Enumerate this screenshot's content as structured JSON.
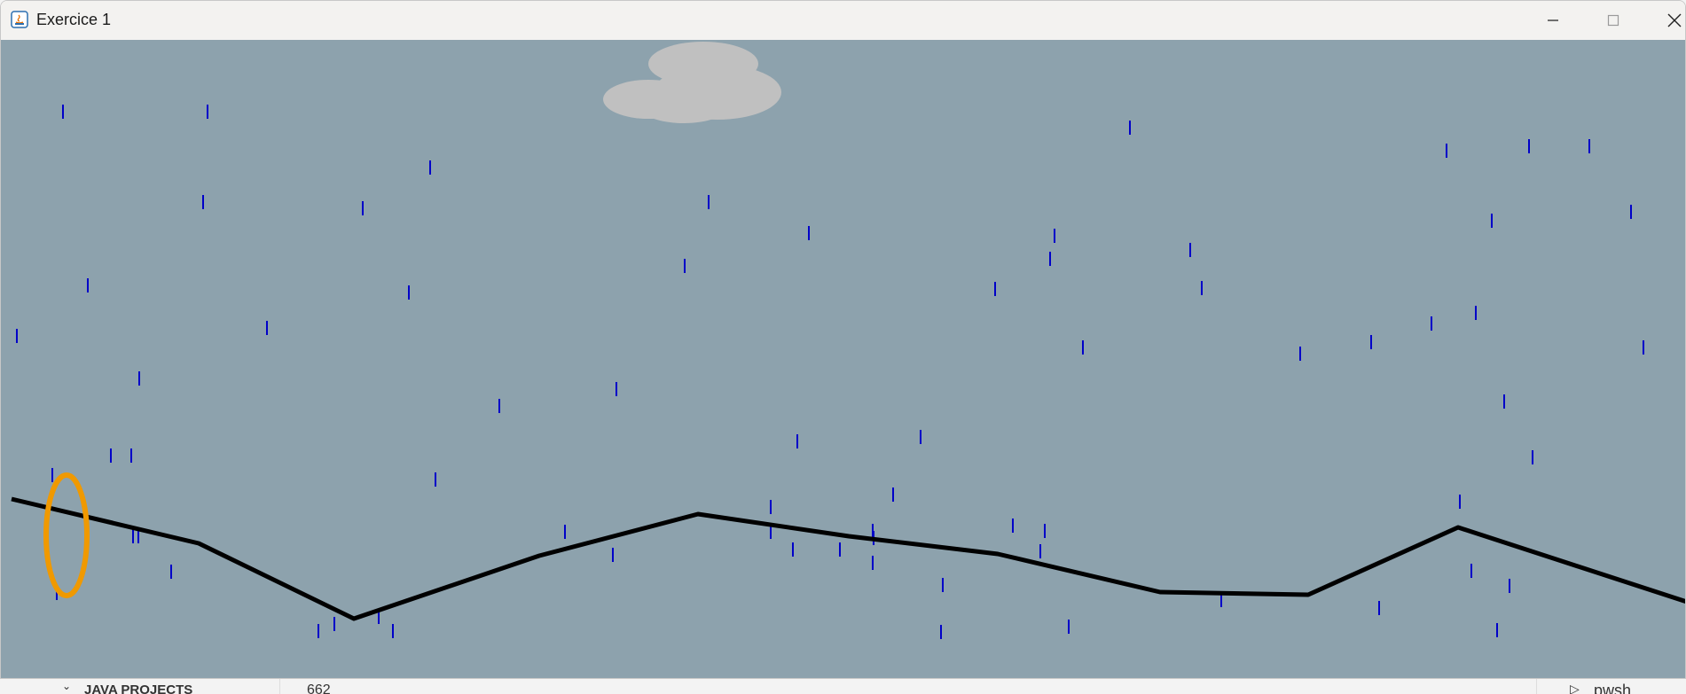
{
  "window": {
    "title": "Exercice 1",
    "app_icon": "java-icon",
    "controls": [
      "minimize-icon",
      "maximize-icon",
      "close-icon"
    ]
  },
  "scene": {
    "sky_color": "#8da2ad",
    "cloud_color": "#c0c0c0",
    "rain_color": "#0000c8",
    "mountain_color": "#000000",
    "ring_color": "#f09900"
  },
  "background_app": {
    "panel_title": "JAVA PROJECTS",
    "panel_value": "662",
    "terminal_label": "pwsh",
    "terminal_icon": "terminal-icon"
  }
}
